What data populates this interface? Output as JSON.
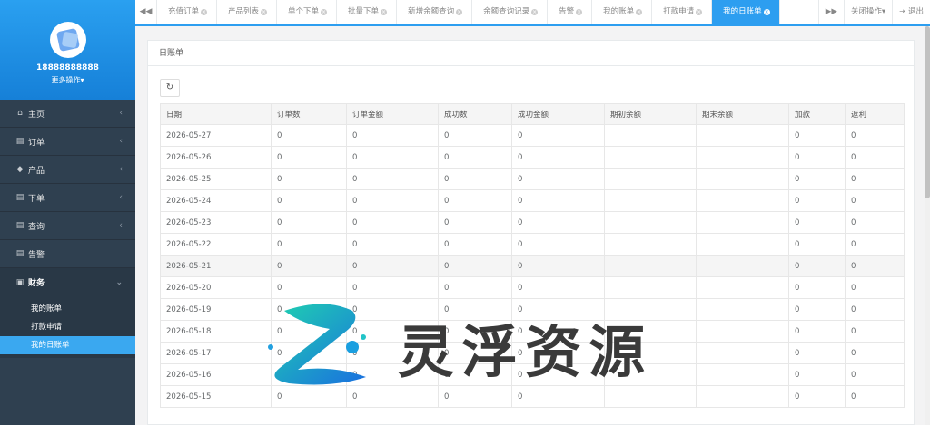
{
  "sidebar": {
    "username": "18888888888",
    "more_ops": "更多操作",
    "items": [
      {
        "label": "主页",
        "icon": "home-icon",
        "glyph": "⌂"
      },
      {
        "label": "订单",
        "icon": "document-icon",
        "glyph": "▤"
      },
      {
        "label": "产品",
        "icon": "cube-icon",
        "glyph": "◆"
      },
      {
        "label": "下单",
        "icon": "edit-icon",
        "glyph": "▤"
      },
      {
        "label": "查询",
        "icon": "search-doc-icon",
        "glyph": "▤"
      },
      {
        "label": "告警",
        "icon": "alert-doc-icon",
        "glyph": "▤"
      }
    ],
    "finance": {
      "label": "财务",
      "icon": "money-icon",
      "glyph": "▣"
    },
    "sub_items": [
      "我的账单",
      "打款申请",
      "我的日账单"
    ]
  },
  "tabs": [
    "充值订单",
    "产品列表",
    "单个下单",
    "批量下单",
    "新增余额查询",
    "余额查询记录",
    "告警",
    "我的账单",
    "打款申请",
    "我的日账单"
  ],
  "tools": {
    "close_ops": "关闭操作",
    "logout": "退出"
  },
  "panel": {
    "title": "日账单"
  },
  "table": {
    "headers": [
      "日期",
      "订单数",
      "订单金额",
      "成功数",
      "成功金额",
      "期初余额",
      "期末余额",
      "加款",
      "返利"
    ],
    "rows": [
      [
        "2026-05-27",
        "0",
        "0",
        "0",
        "0",
        "",
        "",
        "0",
        "0"
      ],
      [
        "2026-05-26",
        "0",
        "0",
        "0",
        "0",
        "",
        "",
        "0",
        "0"
      ],
      [
        "2026-05-25",
        "0",
        "0",
        "0",
        "0",
        "",
        "",
        "0",
        "0"
      ],
      [
        "2026-05-24",
        "0",
        "0",
        "0",
        "0",
        "",
        "",
        "0",
        "0"
      ],
      [
        "2026-05-23",
        "0",
        "0",
        "0",
        "0",
        "",
        "",
        "0",
        "0"
      ],
      [
        "2026-05-22",
        "0",
        "0",
        "0",
        "0",
        "",
        "",
        "0",
        "0"
      ],
      [
        "2026-05-21",
        "0",
        "0",
        "0",
        "0",
        "",
        "",
        "0",
        "0"
      ],
      [
        "2026-05-20",
        "0",
        "0",
        "0",
        "0",
        "",
        "",
        "0",
        "0"
      ],
      [
        "2026-05-19",
        "0",
        "0",
        "0",
        "0",
        "",
        "",
        "0",
        "0"
      ],
      [
        "2026-05-18",
        "0",
        "0",
        "0",
        "0",
        "",
        "",
        "0",
        "0"
      ],
      [
        "2026-05-17",
        "0",
        "0",
        "0",
        "0",
        "",
        "",
        "0",
        "0"
      ],
      [
        "2026-05-16",
        "0",
        "0",
        "0",
        "0",
        "",
        "",
        "0",
        "0"
      ],
      [
        "2026-05-15",
        "0",
        "0",
        "0",
        "0",
        "",
        "",
        "0",
        "0"
      ]
    ]
  },
  "watermark": {
    "text": "灵浮资源"
  },
  "colors": {
    "sidebar": "#2f4050",
    "accent": "#2d9ef0",
    "profile": "#1a8ae6"
  }
}
